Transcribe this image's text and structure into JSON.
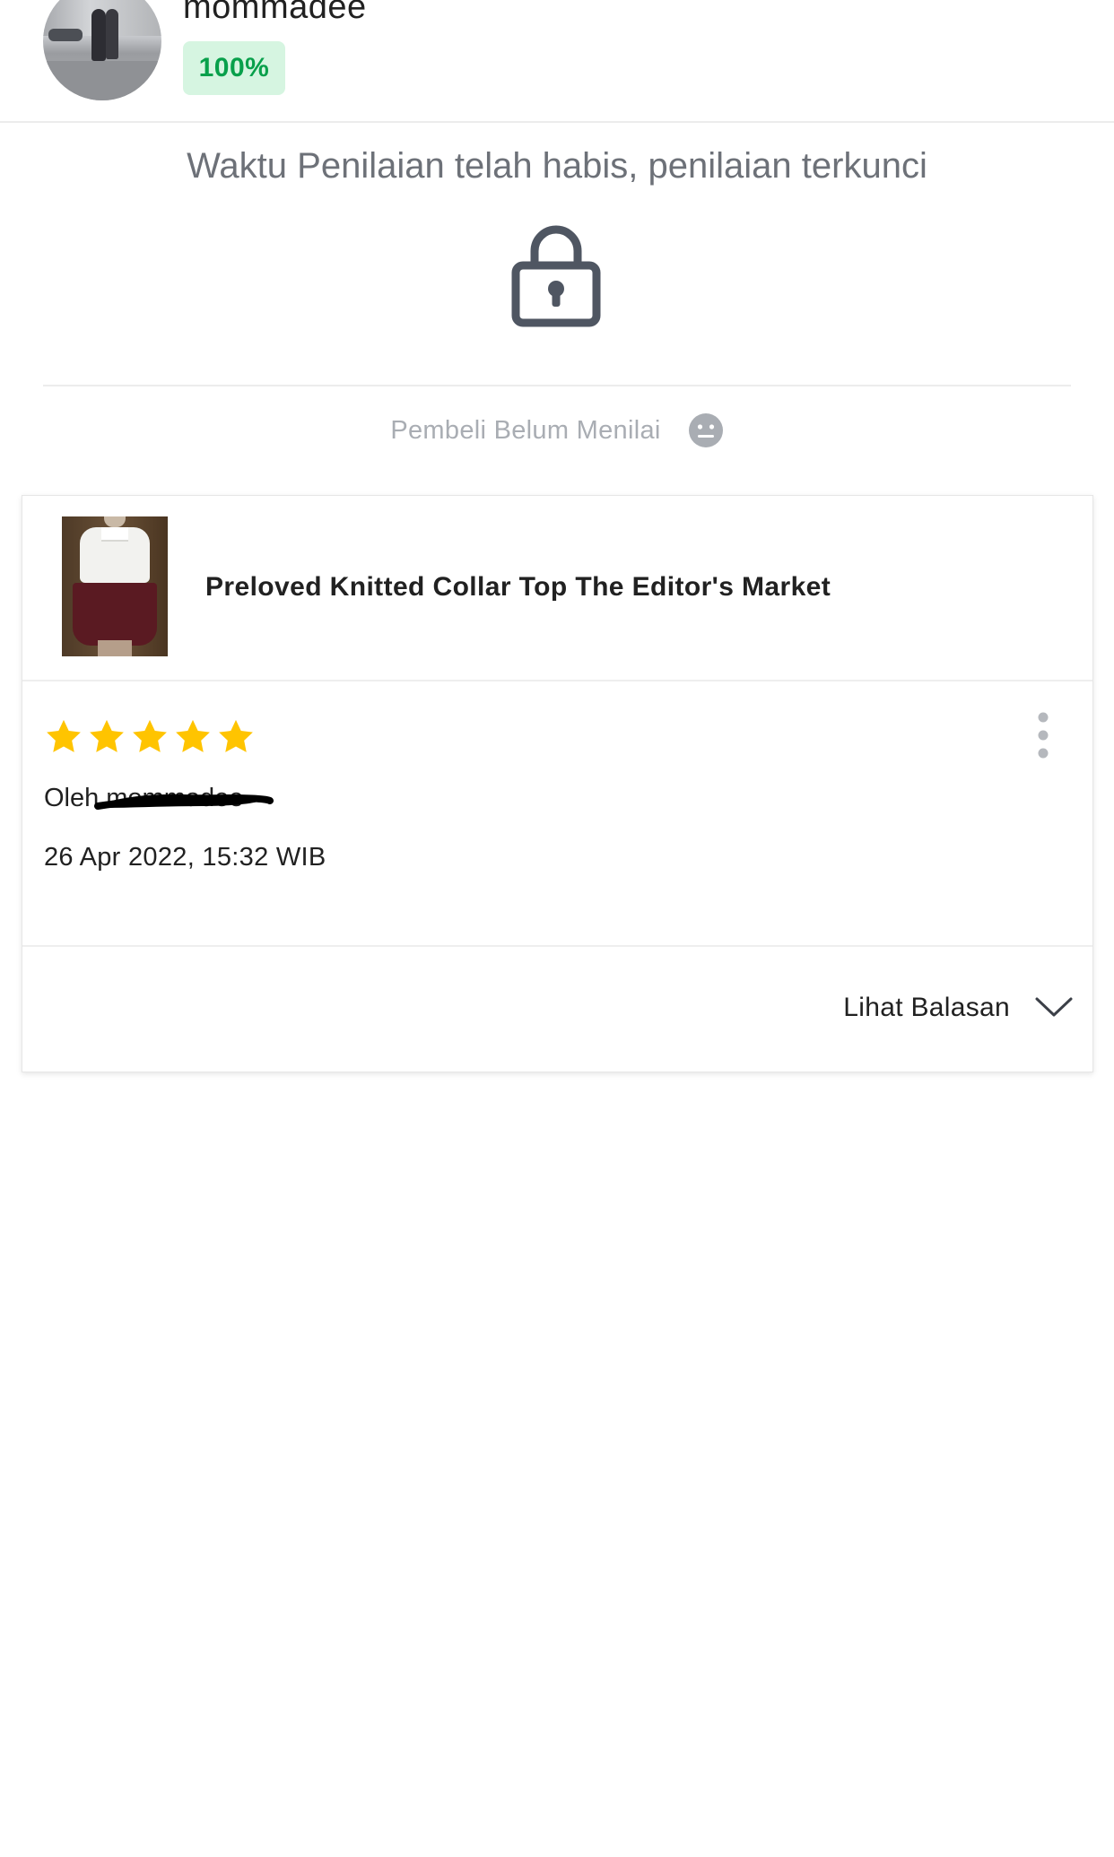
{
  "user": {
    "username": "mommadee",
    "score_badge": "100%",
    "avatar_icon": "user-avatar-photo"
  },
  "lock_notice": {
    "message": "Waktu Penilaian telah habis, penilaian terkunci",
    "icon": "lock-icon"
  },
  "buyer_status": {
    "label": "Pembeli Belum Menilai",
    "icon": "neutral-face-icon"
  },
  "review": {
    "product_name": "Preloved Knitted Collar Top The Editor's Market",
    "product_image_icon": "product-thumbnail",
    "rating": 5,
    "rating_max": 5,
    "star_color": "#ffc400",
    "by_label": "Oleh",
    "reviewer_name": "mommadee",
    "date": "26 Apr 2022, 15:32 WIB",
    "more_icon": "more-vertical-icon",
    "reply_label": "Lihat Balasan",
    "reply_icon": "chevron-down-icon"
  },
  "colors": {
    "badge_bg": "#d6f5e1",
    "badge_text": "#08a04b",
    "muted_text": "#a9adb3",
    "notice_text": "#6d7178",
    "lock_icon": "#4f5662"
  }
}
